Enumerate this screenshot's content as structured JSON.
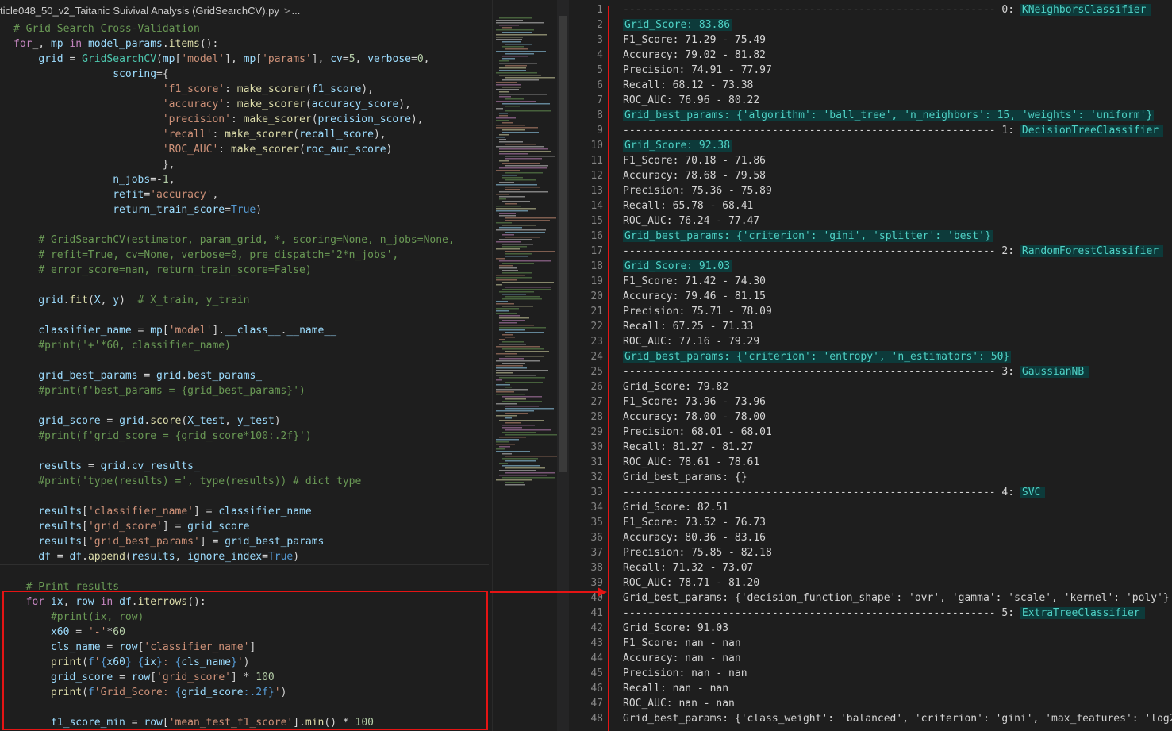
{
  "editor": {
    "breadcrumb": {
      "file": "ticle048_50_v2_Taitanic Suivival Analysis (GridSearchCV).py",
      "sep": ">",
      "more": "..."
    },
    "code_lines": [
      [
        [
          "cm",
          "# Grid Search Cross-Validation"
        ]
      ],
      [
        [
          "kw",
          "for"
        ],
        [
          "",
          "_, "
        ],
        [
          "vr",
          "mp"
        ],
        [
          "",
          ""
        ],
        [
          "kw",
          " in "
        ],
        [
          "vr",
          "model_params"
        ],
        [
          "",
          "."
        ],
        [
          "fn",
          "items"
        ],
        [
          "",
          "():"
        ]
      ],
      [
        [
          "",
          "    "
        ],
        [
          "vr",
          "grid"
        ],
        [
          "",
          " = "
        ],
        [
          "ty",
          "GridSearchCV"
        ],
        [
          "",
          "("
        ],
        [
          "vr",
          "mp"
        ],
        [
          "",
          "["
        ],
        [
          "st",
          "'model'"
        ],
        [
          "",
          "], "
        ],
        [
          "vr",
          "mp"
        ],
        [
          "",
          "["
        ],
        [
          "st",
          "'params'"
        ],
        [
          "",
          "], "
        ],
        [
          "vr",
          "cv"
        ],
        [
          "",
          "="
        ],
        [
          "nu",
          "5"
        ],
        [
          "",
          ", "
        ],
        [
          "vr",
          "verbose"
        ],
        [
          "",
          "="
        ],
        [
          "nu",
          "0"
        ],
        [
          "",
          ","
        ]
      ],
      [
        [
          "",
          "                "
        ],
        [
          "vr",
          "scoring"
        ],
        [
          "",
          "={"
        ]
      ],
      [
        [
          "",
          "                        "
        ],
        [
          "st",
          "'f1_score'"
        ],
        [
          "",
          ": "
        ],
        [
          "fn",
          "make_scorer"
        ],
        [
          "",
          "("
        ],
        [
          "vr",
          "f1_score"
        ],
        [
          "",
          "),"
        ]
      ],
      [
        [
          "",
          "                        "
        ],
        [
          "st",
          "'accuracy'"
        ],
        [
          "",
          ": "
        ],
        [
          "fn",
          "make_scorer"
        ],
        [
          "",
          "("
        ],
        [
          "vr",
          "accuracy_score"
        ],
        [
          "",
          "),"
        ]
      ],
      [
        [
          "",
          "                        "
        ],
        [
          "st",
          "'precision'"
        ],
        [
          "",
          ": "
        ],
        [
          "fn",
          "make_scorer"
        ],
        [
          "",
          "("
        ],
        [
          "vr",
          "precision_score"
        ],
        [
          "",
          "),"
        ]
      ],
      [
        [
          "",
          "                        "
        ],
        [
          "st",
          "'recall'"
        ],
        [
          "",
          ": "
        ],
        [
          "fn",
          "make_scorer"
        ],
        [
          "",
          "("
        ],
        [
          "vr",
          "recall_score"
        ],
        [
          "",
          "),"
        ]
      ],
      [
        [
          "",
          "                        "
        ],
        [
          "st",
          "'ROC_AUC'"
        ],
        [
          "",
          ": "
        ],
        [
          "fn",
          "make_scorer"
        ],
        [
          "",
          "("
        ],
        [
          "vr",
          "roc_auc_score"
        ],
        [
          "",
          ")"
        ]
      ],
      [
        [
          "",
          "                        },"
        ]
      ],
      [
        [
          "",
          "                "
        ],
        [
          "vr",
          "n_jobs"
        ],
        [
          "",
          "=-"
        ],
        [
          "nu",
          "1"
        ],
        [
          "",
          ","
        ]
      ],
      [
        [
          "",
          "                "
        ],
        [
          "vr",
          "refit"
        ],
        [
          "",
          "="
        ],
        [
          "st",
          "'accuracy'"
        ],
        [
          "",
          ","
        ]
      ],
      [
        [
          "",
          "                "
        ],
        [
          "vr",
          "return_train_score"
        ],
        [
          "",
          "="
        ],
        [
          "bl",
          "True"
        ],
        [
          "",
          ")"
        ]
      ],
      [
        [
          "",
          ""
        ]
      ],
      [
        [
          "",
          "    "
        ],
        [
          "cm",
          "# GridSearchCV(estimator, param_grid, *, scoring=None, n_jobs=None,"
        ]
      ],
      [
        [
          "",
          "    "
        ],
        [
          "cm",
          "# refit=True, cv=None, verbose=0, pre_dispatch='2*n_jobs',"
        ]
      ],
      [
        [
          "",
          "    "
        ],
        [
          "cm",
          "# error_score=nan, return_train_score=False)"
        ]
      ],
      [
        [
          "",
          ""
        ]
      ],
      [
        [
          "",
          "    "
        ],
        [
          "vr",
          "grid"
        ],
        [
          "",
          "."
        ],
        [
          "fn",
          "fit"
        ],
        [
          "",
          "("
        ],
        [
          "vr",
          "X"
        ],
        [
          "",
          ", "
        ],
        [
          "vr",
          "y"
        ],
        [
          "",
          ")  "
        ],
        [
          "cm",
          "# X_train, y_train"
        ]
      ],
      [
        [
          "",
          ""
        ]
      ],
      [
        [
          "",
          "    "
        ],
        [
          "vr",
          "classifier_name"
        ],
        [
          "",
          " = "
        ],
        [
          "vr",
          "mp"
        ],
        [
          "",
          "["
        ],
        [
          "st",
          "'model'"
        ],
        [
          "",
          "]."
        ],
        [
          "vr",
          "__class__"
        ],
        [
          "",
          "."
        ],
        [
          "vr",
          "__name__"
        ]
      ],
      [
        [
          "",
          "    "
        ],
        [
          "cm",
          "#print('+'*60, classifier_name)"
        ]
      ],
      [
        [
          "",
          ""
        ]
      ],
      [
        [
          "",
          "    "
        ],
        [
          "vr",
          "grid_best_params"
        ],
        [
          "",
          " = "
        ],
        [
          "vr",
          "grid"
        ],
        [
          "",
          "."
        ],
        [
          "vr",
          "best_params_"
        ]
      ],
      [
        [
          "",
          "    "
        ],
        [
          "cm",
          "#print(f'best_params = {grid_best_params}')"
        ]
      ],
      [
        [
          "",
          ""
        ]
      ],
      [
        [
          "",
          "    "
        ],
        [
          "vr",
          "grid_score"
        ],
        [
          "",
          " = "
        ],
        [
          "vr",
          "grid"
        ],
        [
          "",
          "."
        ],
        [
          "fn",
          "score"
        ],
        [
          "",
          "("
        ],
        [
          "vr",
          "X_test"
        ],
        [
          "",
          ", "
        ],
        [
          "vr",
          "y_test"
        ],
        [
          "",
          ")"
        ]
      ],
      [
        [
          "",
          "    "
        ],
        [
          "cm",
          "#print(f'grid_score = {grid_score*100:.2f}')"
        ]
      ],
      [
        [
          "",
          ""
        ]
      ],
      [
        [
          "",
          "    "
        ],
        [
          "vr",
          "results"
        ],
        [
          "",
          " = "
        ],
        [
          "vr",
          "grid"
        ],
        [
          "",
          "."
        ],
        [
          "vr",
          "cv_results_"
        ]
      ],
      [
        [
          "",
          "    "
        ],
        [
          "cm",
          "#print('type(results) =', type(results)) # dict type"
        ]
      ],
      [
        [
          "",
          ""
        ]
      ],
      [
        [
          "",
          "    "
        ],
        [
          "vr",
          "results"
        ],
        [
          "",
          "["
        ],
        [
          "st",
          "'classifier_name'"
        ],
        [
          "",
          "] = "
        ],
        [
          "vr",
          "classifier_name"
        ]
      ],
      [
        [
          "",
          "    "
        ],
        [
          "vr",
          "results"
        ],
        [
          "",
          "["
        ],
        [
          "st",
          "'grid_score'"
        ],
        [
          "",
          "] = "
        ],
        [
          "vr",
          "grid_score"
        ]
      ],
      [
        [
          "",
          "    "
        ],
        [
          "vr",
          "results"
        ],
        [
          "",
          "["
        ],
        [
          "st",
          "'grid_best_params'"
        ],
        [
          "",
          "] = "
        ],
        [
          "vr",
          "grid_best_params"
        ]
      ],
      [
        [
          "",
          "    "
        ],
        [
          "vr",
          "df"
        ],
        [
          "",
          " = "
        ],
        [
          "vr",
          "df"
        ],
        [
          "",
          "."
        ],
        [
          "fn",
          "append"
        ],
        [
          "",
          "("
        ],
        [
          "vr",
          "results"
        ],
        [
          "",
          ", "
        ],
        [
          "vr",
          "ignore_index"
        ],
        [
          "",
          "="
        ],
        [
          "bl",
          "True"
        ],
        [
          "",
          ")"
        ]
      ],
      [
        [
          "",
          ""
        ]
      ],
      [
        [
          "",
          "  "
        ],
        [
          "cm",
          "# Print results"
        ]
      ],
      [
        [
          "",
          "  "
        ],
        [
          "kw",
          "for"
        ],
        [
          "",
          " "
        ],
        [
          "vr",
          "ix"
        ],
        [
          "",
          ", "
        ],
        [
          "vr",
          "row"
        ],
        [
          "kw",
          " in "
        ],
        [
          "vr",
          "df"
        ],
        [
          "",
          "."
        ],
        [
          "fn",
          "iterrows"
        ],
        [
          "",
          "():"
        ]
      ],
      [
        [
          "",
          "      "
        ],
        [
          "cm",
          "#print(ix, row)"
        ]
      ],
      [
        [
          "",
          "      "
        ],
        [
          "vr",
          "x60"
        ],
        [
          "",
          " = "
        ],
        [
          "st",
          "'-'"
        ],
        [
          "",
          "*"
        ],
        [
          "nu",
          "60"
        ]
      ],
      [
        [
          "",
          "      "
        ],
        [
          "vr",
          "cls_name"
        ],
        [
          "",
          " = "
        ],
        [
          "vr",
          "row"
        ],
        [
          "",
          "["
        ],
        [
          "st",
          "'classifier_name'"
        ],
        [
          "",
          "]"
        ]
      ],
      [
        [
          "",
          "      "
        ],
        [
          "fn",
          "print"
        ],
        [
          "",
          "("
        ],
        [
          "bl",
          "f"
        ],
        [
          "st",
          "'"
        ],
        [
          "bl",
          "{"
        ],
        [
          "vr",
          "x60"
        ],
        [
          "bl",
          "}"
        ],
        [
          "st",
          " "
        ],
        [
          "bl",
          "{"
        ],
        [
          "vr",
          "ix"
        ],
        [
          "bl",
          "}"
        ],
        [
          "st",
          ": "
        ],
        [
          "bl",
          "{"
        ],
        [
          "vr",
          "cls_name"
        ],
        [
          "bl",
          "}"
        ],
        [
          "st",
          "'"
        ],
        [
          "",
          ")"
        ]
      ],
      [
        [
          "",
          "      "
        ],
        [
          "vr",
          "grid_score"
        ],
        [
          "",
          " = "
        ],
        [
          "vr",
          "row"
        ],
        [
          "",
          "["
        ],
        [
          "st",
          "'grid_score'"
        ],
        [
          "",
          "] * "
        ],
        [
          "nu",
          "100"
        ]
      ],
      [
        [
          "",
          "      "
        ],
        [
          "fn",
          "print"
        ],
        [
          "",
          "("
        ],
        [
          "bl",
          "f"
        ],
        [
          "st",
          "'Grid_Score: "
        ],
        [
          "bl",
          "{"
        ],
        [
          "vr",
          "grid_score"
        ],
        [
          "bl",
          ":.2f}"
        ],
        [
          "st",
          "'"
        ],
        [
          "",
          ")"
        ]
      ],
      [
        [
          "",
          ""
        ]
      ],
      [
        [
          "",
          "      "
        ],
        [
          "vr",
          "f1_score_min"
        ],
        [
          "",
          " = "
        ],
        [
          "vr",
          "row"
        ],
        [
          "",
          "["
        ],
        [
          "st",
          "'mean_test_f1_score'"
        ],
        [
          "",
          "]."
        ],
        [
          "fn",
          "min"
        ],
        [
          "",
          "() * "
        ],
        [
          "nu",
          "100"
        ]
      ]
    ]
  },
  "output": {
    "lines": [
      {
        "n": "1",
        "t": "------------------------------------------------------------ 0: ",
        "tag": "KNeighborsClassifier"
      },
      {
        "n": "2",
        "t": "Grid_Score: 83.86",
        "hl": true
      },
      {
        "n": "3",
        "t": "F1_Score: 71.29 - 75.49"
      },
      {
        "n": "4",
        "t": "Accuracy: 79.02 - 81.82"
      },
      {
        "n": "5",
        "t": "Precision: 74.91 - 77.97"
      },
      {
        "n": "6",
        "t": "Recall: 68.12 - 73.38"
      },
      {
        "n": "7",
        "t": "ROC_AUC: 76.96 - 80.22"
      },
      {
        "n": "8",
        "t": "Grid_best_params: {'algorithm': 'ball_tree', 'n_neighbors': 15, 'weights': 'uniform'}",
        "hl": true
      },
      {
        "n": "9",
        "t": "------------------------------------------------------------ 1: ",
        "tag": "DecisionTreeClassifier"
      },
      {
        "n": "10",
        "t": "Grid_Score: 92.38",
        "hl": true
      },
      {
        "n": "11",
        "t": "F1_Score: 70.18 - 71.86"
      },
      {
        "n": "12",
        "t": "Accuracy: 78.68 - 79.58"
      },
      {
        "n": "13",
        "t": "Precision: 75.36 - 75.89"
      },
      {
        "n": "14",
        "t": "Recall: 65.78 - 68.41"
      },
      {
        "n": "15",
        "t": "ROC_AUC: 76.24 - 77.47"
      },
      {
        "n": "16",
        "t": "Grid_best_params: {'criterion': 'gini', 'splitter': 'best'}",
        "hl": true
      },
      {
        "n": "17",
        "t": "------------------------------------------------------------ 2: ",
        "tag": "RandomForestClassifier"
      },
      {
        "n": "18",
        "t": "Grid_Score: 91.03",
        "hl": true
      },
      {
        "n": "19",
        "t": "F1_Score: 71.42 - 74.30"
      },
      {
        "n": "20",
        "t": "Accuracy: 79.46 - 81.15"
      },
      {
        "n": "21",
        "t": "Precision: 75.71 - 78.09"
      },
      {
        "n": "22",
        "t": "Recall: 67.25 - 71.33"
      },
      {
        "n": "23",
        "t": "ROC_AUC: 77.16 - 79.29"
      },
      {
        "n": "24",
        "t": "Grid_best_params: {'criterion': 'entropy', 'n_estimators': 50}",
        "hl": true
      },
      {
        "n": "25",
        "t": "------------------------------------------------------------ 3: ",
        "tag": "GaussianNB"
      },
      {
        "n": "26",
        "t": "Grid_Score: 79.82"
      },
      {
        "n": "27",
        "t": "F1_Score: 73.96 - 73.96"
      },
      {
        "n": "28",
        "t": "Accuracy: 78.00 - 78.00"
      },
      {
        "n": "29",
        "t": "Precision: 68.01 - 68.01"
      },
      {
        "n": "30",
        "t": "Recall: 81.27 - 81.27"
      },
      {
        "n": "31",
        "t": "ROC_AUC: 78.61 - 78.61"
      },
      {
        "n": "32",
        "t": "Grid_best_params: {}"
      },
      {
        "n": "33",
        "t": "------------------------------------------------------------ 4: ",
        "tag": "SVC"
      },
      {
        "n": "34",
        "t": "Grid_Score: 82.51"
      },
      {
        "n": "35",
        "t": "F1_Score: 73.52 - 76.73"
      },
      {
        "n": "36",
        "t": "Accuracy: 80.36 - 83.16"
      },
      {
        "n": "37",
        "t": "Precision: 75.85 - 82.18"
      },
      {
        "n": "38",
        "t": "Recall: 71.32 - 73.07"
      },
      {
        "n": "39",
        "t": "ROC_AUC: 78.71 - 81.20"
      },
      {
        "n": "40",
        "t": "Grid_best_params: {'decision_function_shape': 'ovr', 'gamma': 'scale', 'kernel': 'poly'}"
      },
      {
        "n": "41",
        "t": "------------------------------------------------------------ 5: ",
        "tag": "ExtraTreeClassifier"
      },
      {
        "n": "42",
        "t": "Grid_Score: 91.03"
      },
      {
        "n": "43",
        "t": "F1_Score: nan - nan"
      },
      {
        "n": "44",
        "t": "Accuracy: nan - nan"
      },
      {
        "n": "45",
        "t": "Precision: nan - nan"
      },
      {
        "n": "46",
        "t": "Recall: nan - nan"
      },
      {
        "n": "47",
        "t": "ROC_AUC: nan - nan"
      },
      {
        "n": "48",
        "t": "Grid_best_params: {'class_weight': 'balanced', 'criterion': 'gini', 'max_features': 'log2"
      }
    ]
  },
  "colors": {
    "annotation_red": "#e51414",
    "highlight_teal": "#4fd1c5"
  }
}
